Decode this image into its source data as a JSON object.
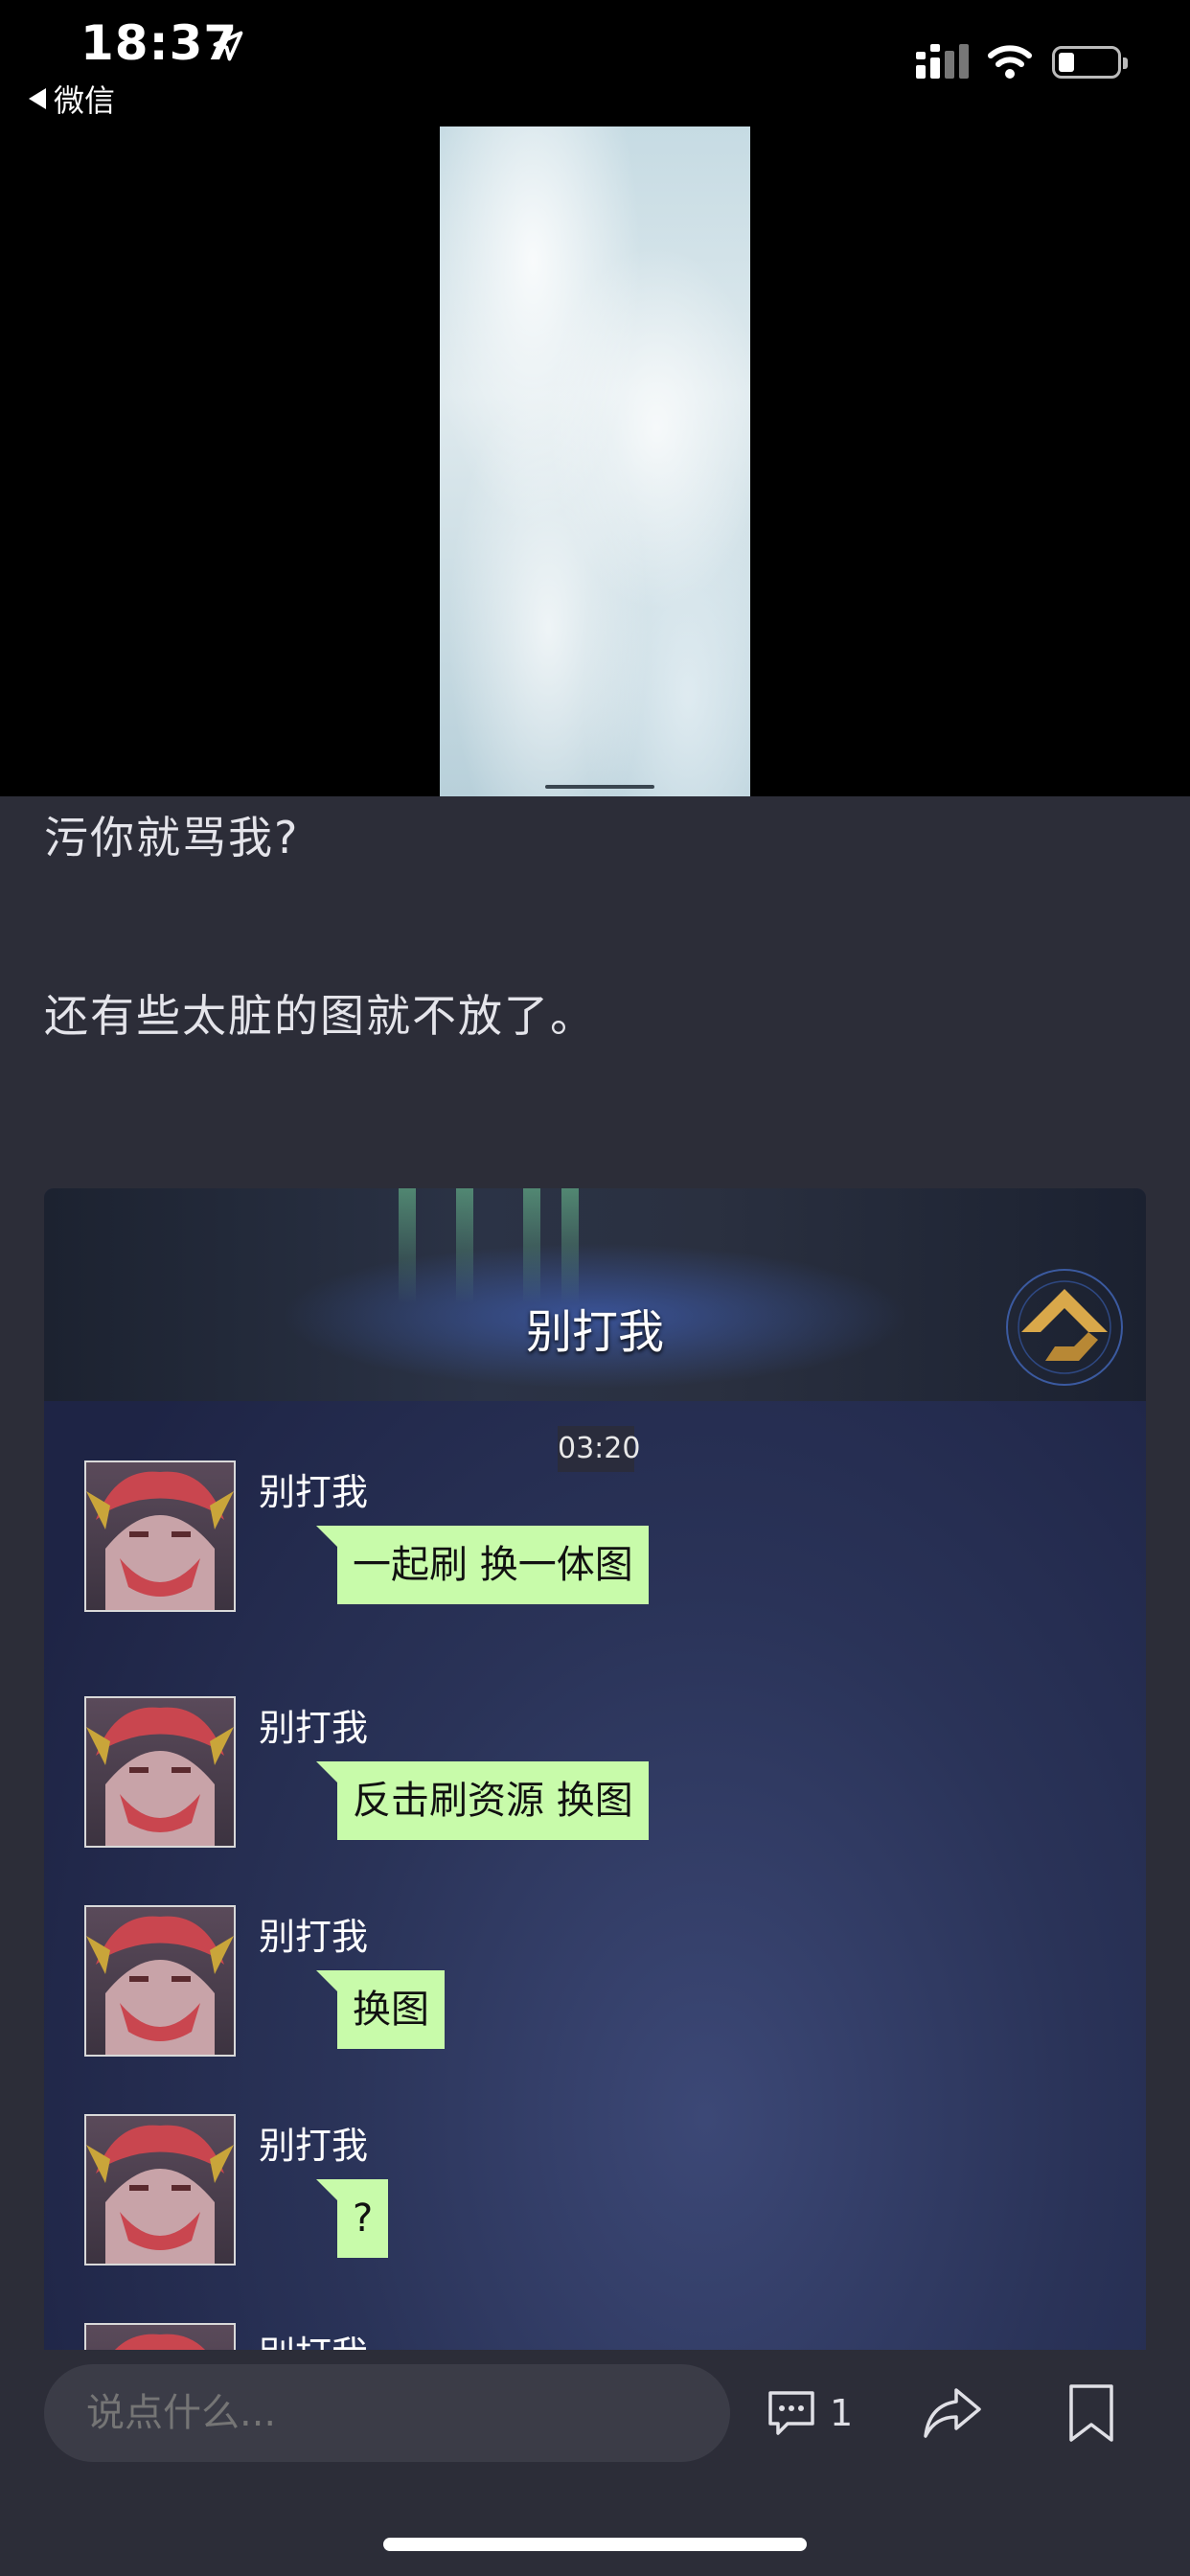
{
  "status_bar": {
    "time": "18:37",
    "back_app": "微信"
  },
  "article": {
    "paragraphs": [
      "污你就骂我?",
      "还有些太脏的图就不放了。"
    ]
  },
  "game_screenshot": {
    "title": "别打我",
    "timestamp": "03:20",
    "messages": [
      {
        "sender": "别打我",
        "text": "一起刷 换一体图"
      },
      {
        "sender": "别打我",
        "text": "反击刷资源 换图"
      },
      {
        "sender": "别打我",
        "text": "换图"
      },
      {
        "sender": "别打我",
        "text": "?"
      },
      {
        "sender": "别打我",
        "text": ""
      }
    ]
  },
  "bottom_bar": {
    "comment_placeholder": "说点什么...",
    "comment_count": "1"
  },
  "colors": {
    "page_bg": "#2c2d38",
    "bubble_bg": "#c8fbaa",
    "text": "#e4e4ea"
  },
  "icons": [
    "location-arrow-icon",
    "back-triangle-icon",
    "signal-icon",
    "wifi-icon",
    "battery-icon",
    "rank-emblem-icon",
    "comment-icon",
    "share-icon",
    "bookmark-icon"
  ]
}
